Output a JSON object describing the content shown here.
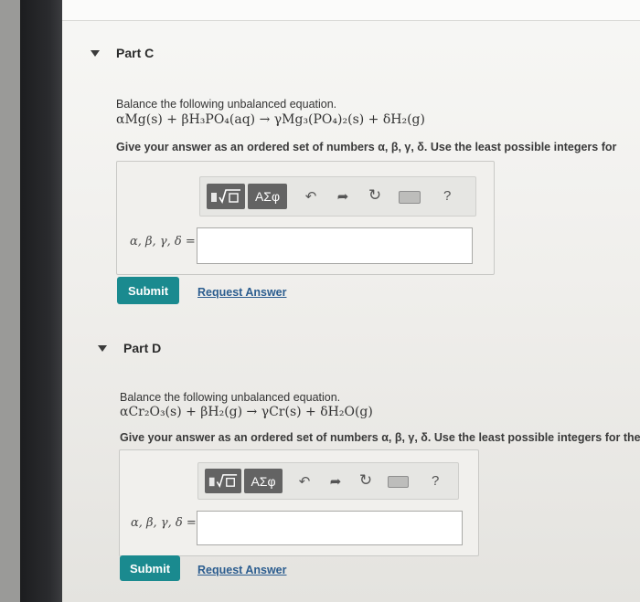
{
  "partC": {
    "title": "Part C",
    "prompt": "Balance the following unbalanced equation.",
    "equation": "αMg(s) + βH₃PO₄(aq) → γMg₃(PO₄)₂(s) + δH₂(g)",
    "instruction": "Give your answer as an ordered set of numbers α, β, γ, δ. Use the least possible integers for",
    "toolbar": {
      "templates_icon": "templates-sqrt-icon",
      "symbols_label": "ΑΣφ",
      "help_label": "?"
    },
    "input_label": "α, β, γ, δ =",
    "input_value": "",
    "submit_label": "Submit",
    "request_label": "Request Answer"
  },
  "partD": {
    "title": "Part D",
    "prompt": "Balance the following unbalanced equation.",
    "equation": "αCr₂O₃(s) + βH₂(g) → γCr(s) + δH₂O(g)",
    "instruction": "Give your answer as an ordered set of numbers α, β, γ, δ. Use the least possible integers for the",
    "toolbar": {
      "templates_icon": "templates-sqrt-icon",
      "symbols_label": "ΑΣφ",
      "help_label": "?"
    },
    "input_label": "α, β, γ, δ =",
    "input_value": "",
    "submit_label": "Submit",
    "request_label": "Request Answer"
  },
  "colors": {
    "submit": "#1a8a8f",
    "link": "#2c5d8f",
    "toolbar_button": "#636363"
  }
}
